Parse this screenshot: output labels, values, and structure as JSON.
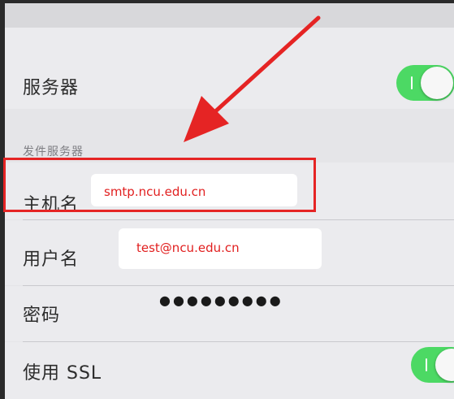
{
  "server_row": {
    "label": "服务器",
    "toggle_on": true
  },
  "outgoing_section": {
    "header": "发件服务器"
  },
  "hostname_row": {
    "label": "主机名",
    "value": "smtp.ncu.edu.cn"
  },
  "username_row": {
    "label": "用户名",
    "value": "test@ncu.edu.cn"
  },
  "password_row": {
    "label": "密码",
    "value": "●●●●●●●●●"
  },
  "ssl_row": {
    "label": "使用 SSL",
    "toggle_on": true
  },
  "colors": {
    "toggle_on": "#4cd964",
    "annotation_red": "#e52424",
    "value_text": "#e11f1f",
    "background": "#e5e5e8"
  }
}
